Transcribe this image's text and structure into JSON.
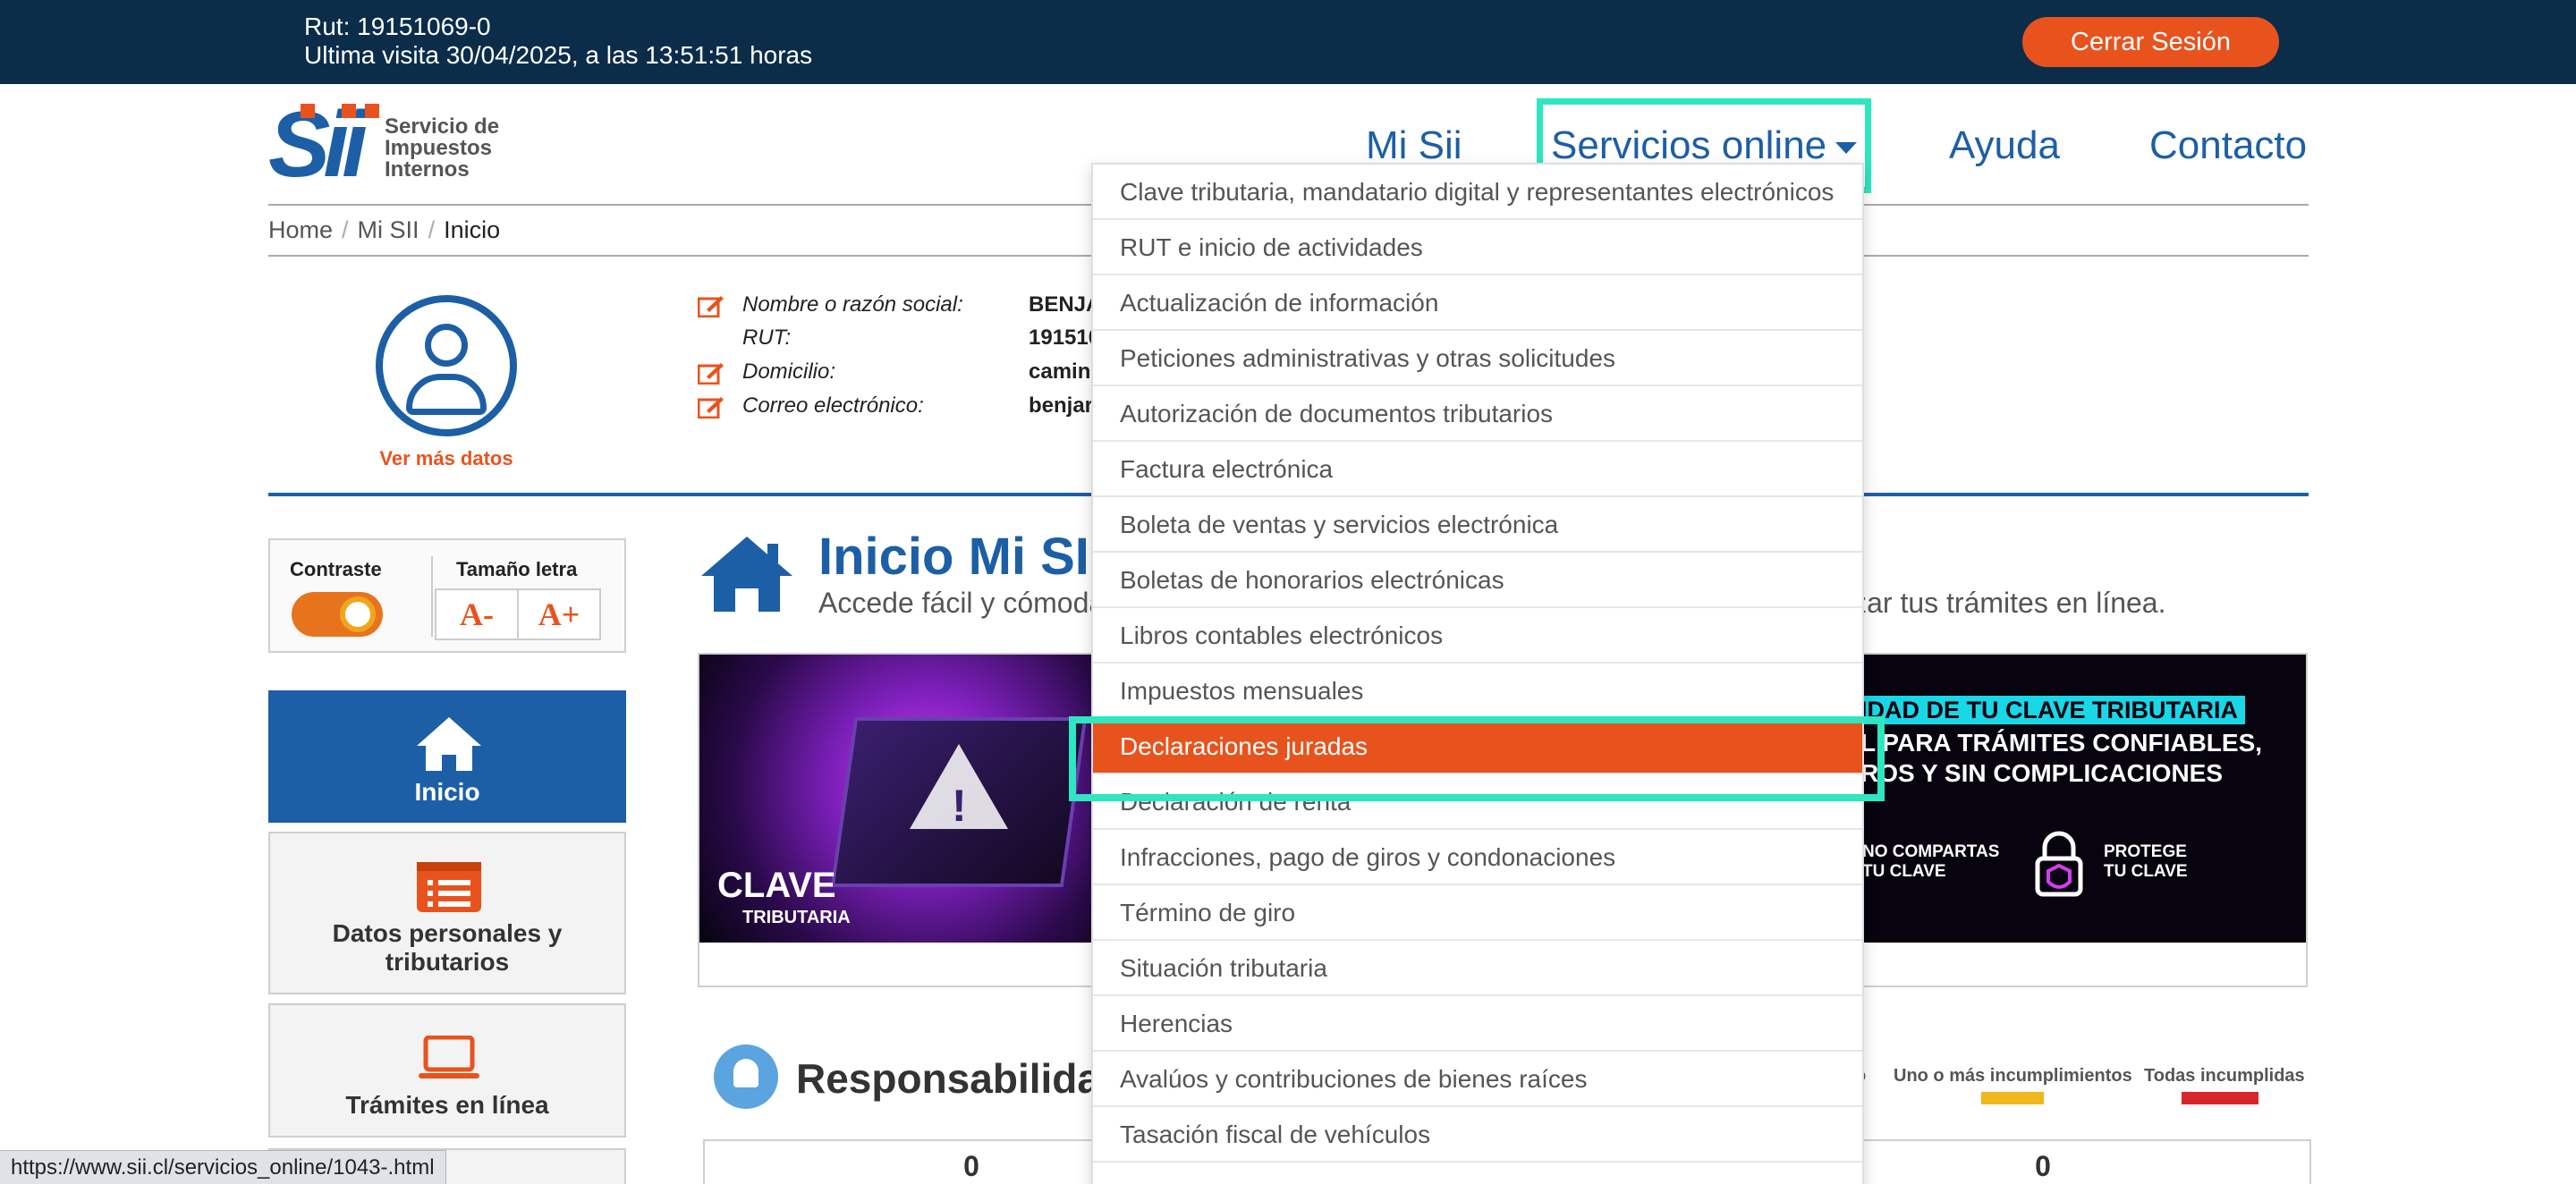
{
  "session": {
    "rut_line": "Rut: 19151069-0",
    "visit_line": "Ultima visita 30/04/2025, a las 13:51:51 horas",
    "logout_label": "Cerrar Sesión"
  },
  "logo": {
    "mark": "Sii",
    "text_line1": "Servicio de",
    "text_line2": "Impuestos",
    "text_line3": "Internos"
  },
  "nav": {
    "mi_sii": "Mi Sii",
    "servicios": "Servicios online",
    "ayuda": "Ayuda",
    "contacto": "Contacto"
  },
  "breadcrumb": [
    "Home",
    "Mi SII",
    "Inicio"
  ],
  "profile": {
    "more_data": "Ver más datos",
    "rows": [
      {
        "label": "Nombre o razón social:",
        "value": "BENJA"
      },
      {
        "label": "RUT:",
        "value": "191510"
      },
      {
        "label": "Domicilio:",
        "value": "camino"
      },
      {
        "label": "Correo electrónico:",
        "value": "benjar"
      }
    ]
  },
  "accessibility": {
    "contrast_label": "Contraste",
    "font_size_label": "Tamaño letra",
    "decrease": "A-",
    "increase": "A+"
  },
  "side_menu": [
    {
      "label": "Inicio",
      "icon": "home-icon"
    },
    {
      "label": "Datos personales y tributarios",
      "icon": "list-icon"
    },
    {
      "label": "Trámites en línea",
      "icon": "laptop-icon"
    }
  ],
  "main": {
    "title": "Inicio Mi SII",
    "subtitle_left": "Accede fácil y cómoda",
    "subtitle_right": "izar tus trámites en línea."
  },
  "banner": {
    "brand": "CLAVE",
    "brand_sub": "TRIBUTARIA",
    "headline1": "IDAD DE TU CLAVE TRIBUTARIA",
    "headline2": "L PARA TRÁMITES CONFIABLES,",
    "headline3": "ROS Y SIN COMPLICACIONES",
    "item1_line1": "NO COMPARTAS",
    "item1_line2": "TU CLAVE",
    "item2_line1": "PROTEGE",
    "item2_line2": "TU CLAVE"
  },
  "responsibilities": {
    "title": "Responsabilidad",
    "legend_cut": "o",
    "legend": [
      {
        "label": "Uno o más incumplimientos",
        "color": "#f2b71d"
      },
      {
        "label": "Todas incumplidas",
        "color": "#d9262b"
      }
    ],
    "counter_left": "0",
    "counter_right": "0"
  },
  "dropdown": {
    "selected_index": 10,
    "items": [
      "Clave tributaria, mandatario digital y representantes electrónicos",
      "RUT e inicio de actividades",
      "Actualización de información",
      "Peticiones administrativas y otras solicitudes",
      "Autorización de documentos tributarios",
      "Factura electrónica",
      "Boleta de ventas y servicios electrónica",
      "Boletas de honorarios electrónicas",
      "Libros contables electrónicos",
      "Impuestos mensuales",
      "Declaraciones juradas",
      "Declaración de renta",
      "Infracciones, pago de giros y condonaciones",
      "Término de giro",
      "Situación tributaria",
      "Herencias",
      "Avalúos y contribuciones de bienes raíces",
      "Tasación fiscal de vehículos"
    ]
  },
  "status_url": "https://www.sii.cl/servicios_online/1043-.html",
  "colors": {
    "navy": "#0b2d4a",
    "brand_blue": "#1c5fa6",
    "orange": "#e8531d",
    "focus": "#2ee6c0"
  }
}
